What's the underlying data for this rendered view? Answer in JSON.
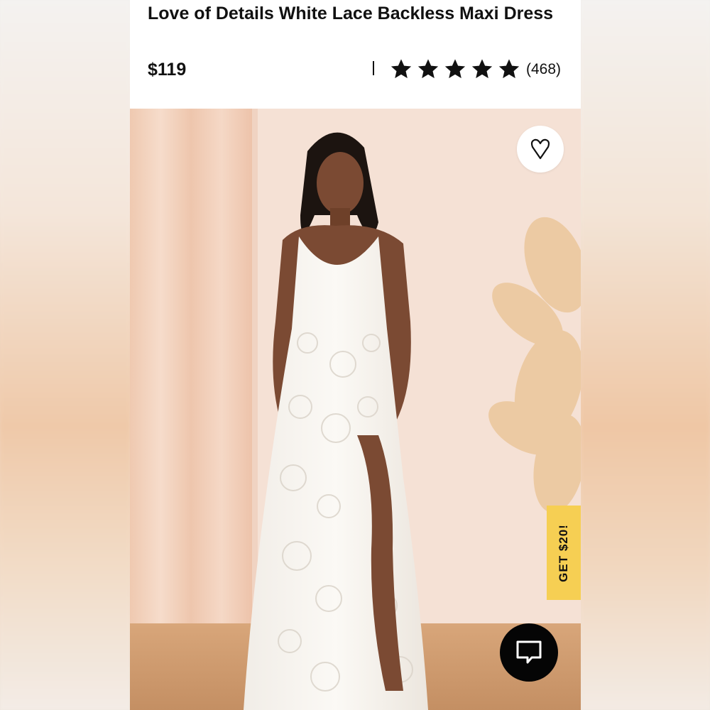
{
  "product": {
    "title": "Love of Details White Lace Backless Maxi Dress",
    "price": "$119",
    "rating": 5,
    "review_count": "(468)"
  },
  "icons": {
    "favorite": "heart-outline-icon",
    "chat": "chat-bubble-icon",
    "star": "star-icon"
  },
  "promo": {
    "label": "GET $20!"
  },
  "colors": {
    "promo_bg": "#f6cf53",
    "chat_bg": "#050505",
    "text": "#111111"
  }
}
